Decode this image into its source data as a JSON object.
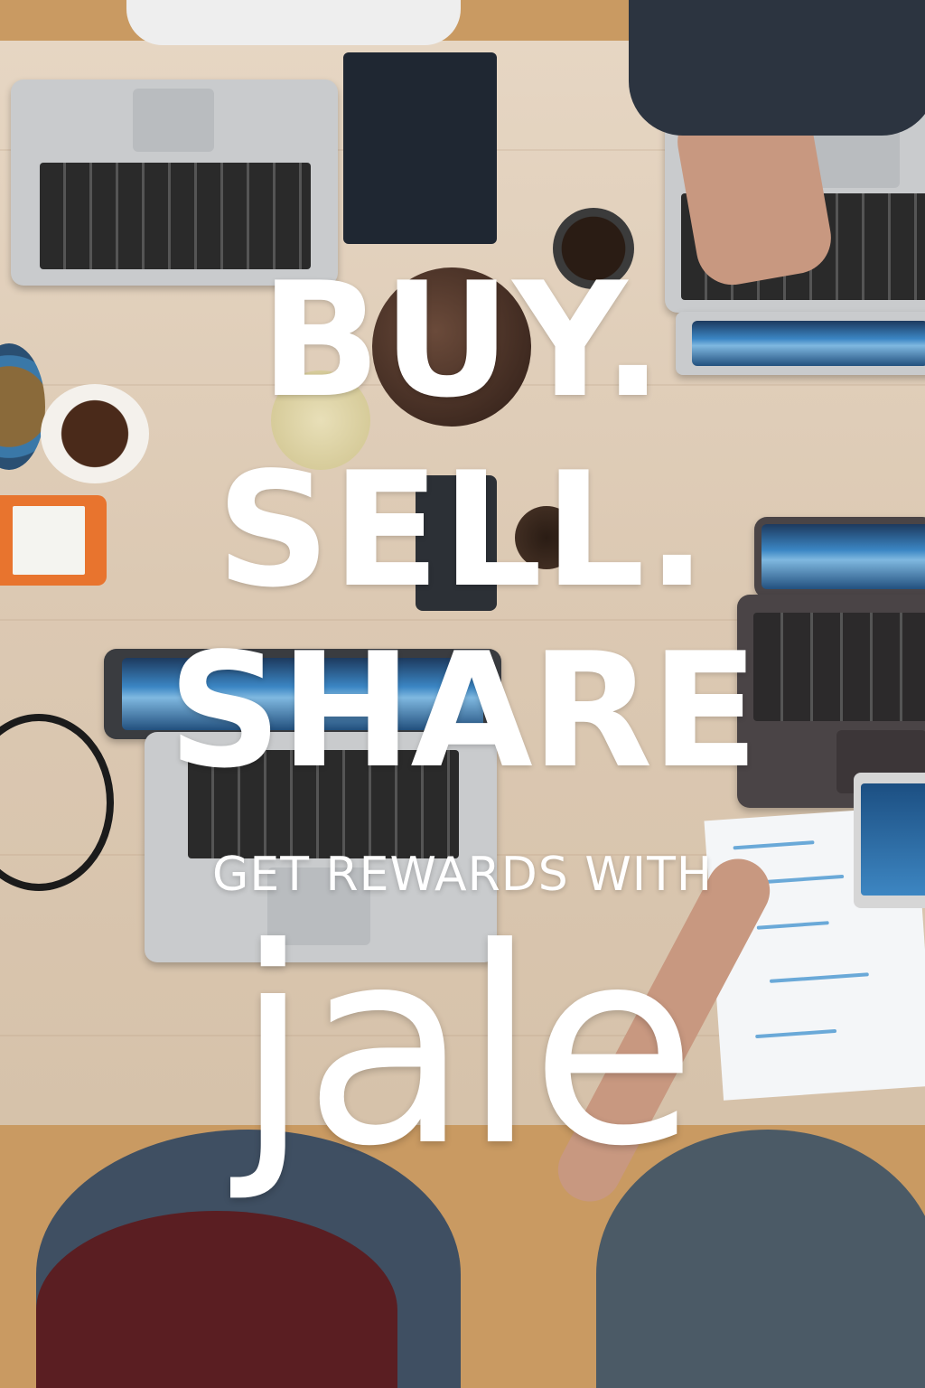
{
  "poster": {
    "line1": "BUY.",
    "line2": "SELL.",
    "line3": "SHARE",
    "tagline": "GET REWARDS WITH",
    "brand": "jale"
  },
  "colors": {
    "text": "#ffffff",
    "table": "#e0cfba",
    "drive_accent": "#e8742e"
  },
  "background": {
    "subject": "overhead-workspace-photo"
  }
}
